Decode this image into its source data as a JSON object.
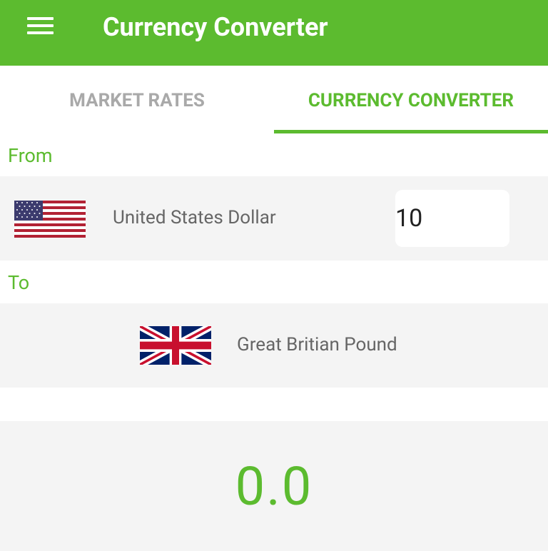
{
  "app": {
    "title": "Currency Converter",
    "menu_icon": "hamburger-menu-icon",
    "accent_color": "#5cbb2f"
  },
  "tabs": [
    {
      "label": "MARKET RATES",
      "active": false
    },
    {
      "label": "CURRENCY CONVERTER",
      "active": true
    }
  ],
  "from": {
    "label": "From",
    "currency_name": "United States Dollar",
    "flag_icon": "us-flag-icon",
    "amount": "10"
  },
  "to": {
    "label": "To",
    "currency_name": "Great Britian Pound",
    "flag_icon": "uk-flag-icon"
  },
  "result": {
    "value": "0.0"
  }
}
